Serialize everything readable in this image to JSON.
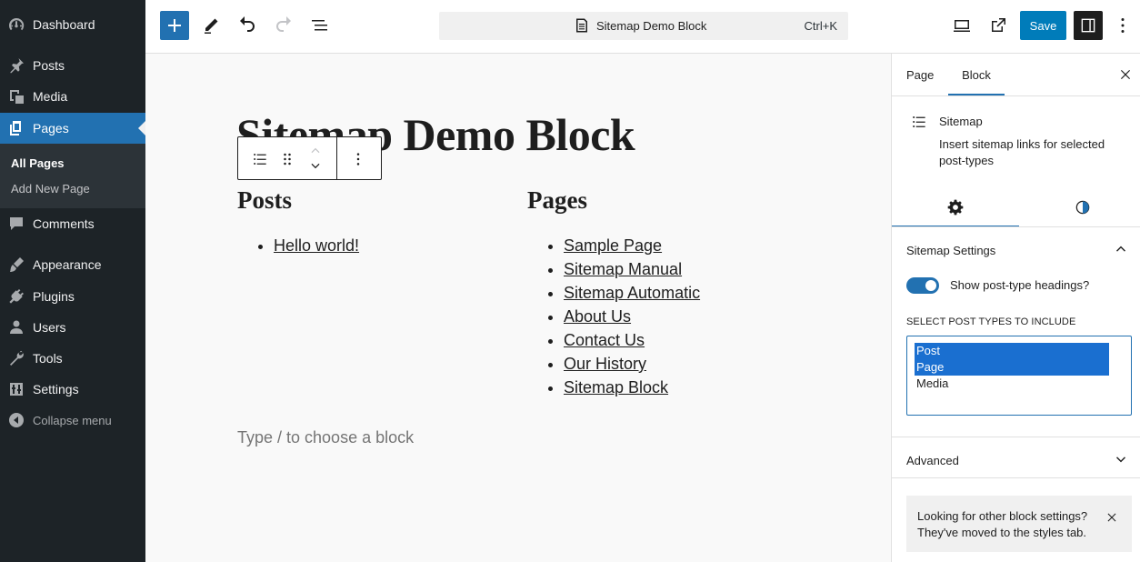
{
  "admin_menu": {
    "items": [
      {
        "label": "Dashboard",
        "icon": "dashboard-icon"
      },
      {
        "label": "Posts",
        "icon": "pin-icon"
      },
      {
        "label": "Media",
        "icon": "media-icon"
      },
      {
        "label": "Pages",
        "icon": "pages-icon",
        "current": true
      },
      {
        "label": "Comments",
        "icon": "comment-icon"
      },
      {
        "label": "Appearance",
        "icon": "brush-icon"
      },
      {
        "label": "Plugins",
        "icon": "plugin-icon"
      },
      {
        "label": "Users",
        "icon": "user-icon"
      },
      {
        "label": "Tools",
        "icon": "wrench-icon"
      },
      {
        "label": "Settings",
        "icon": "sliders-icon"
      }
    ],
    "submenu": [
      "All Pages",
      "Add New Page"
    ],
    "collapse_label": "Collapse menu"
  },
  "toolbar": {
    "document_title": "Sitemap Demo Block",
    "shortcut": "Ctrl+K",
    "save_label": "Save"
  },
  "canvas": {
    "post_title": "Sitemap Demo Block",
    "columns": [
      {
        "heading": "Posts",
        "links": [
          "Hello world!"
        ]
      },
      {
        "heading": "Pages",
        "links": [
          "Sample Page",
          "Sitemap Manual",
          "Sitemap Automatic",
          "About Us",
          "Contact Us",
          "Our History",
          "Sitemap Block"
        ]
      }
    ],
    "placeholder": "Type / to choose a block"
  },
  "settings_panel": {
    "tabs": [
      "Page",
      "Block"
    ],
    "active_tab": "Block",
    "block_card": {
      "title": "Sitemap",
      "description": "Insert sitemap links for selected post-types"
    },
    "panel_title": "Sitemap Settings",
    "toggle_label": "Show post-type headings?",
    "toggle_on": true,
    "select_label": "SELECT POST TYPES TO INCLUDE",
    "select_options": [
      {
        "label": "Post",
        "selected": true
      },
      {
        "label": "Page",
        "selected": true
      },
      {
        "label": "Media",
        "selected": false
      }
    ],
    "advanced_title": "Advanced",
    "notice": "Looking for other block settings? They've moved to the styles tab."
  },
  "colors": {
    "admin_bg": "#1d2327",
    "accent": "#2271b1",
    "save_button": "#007cba"
  }
}
